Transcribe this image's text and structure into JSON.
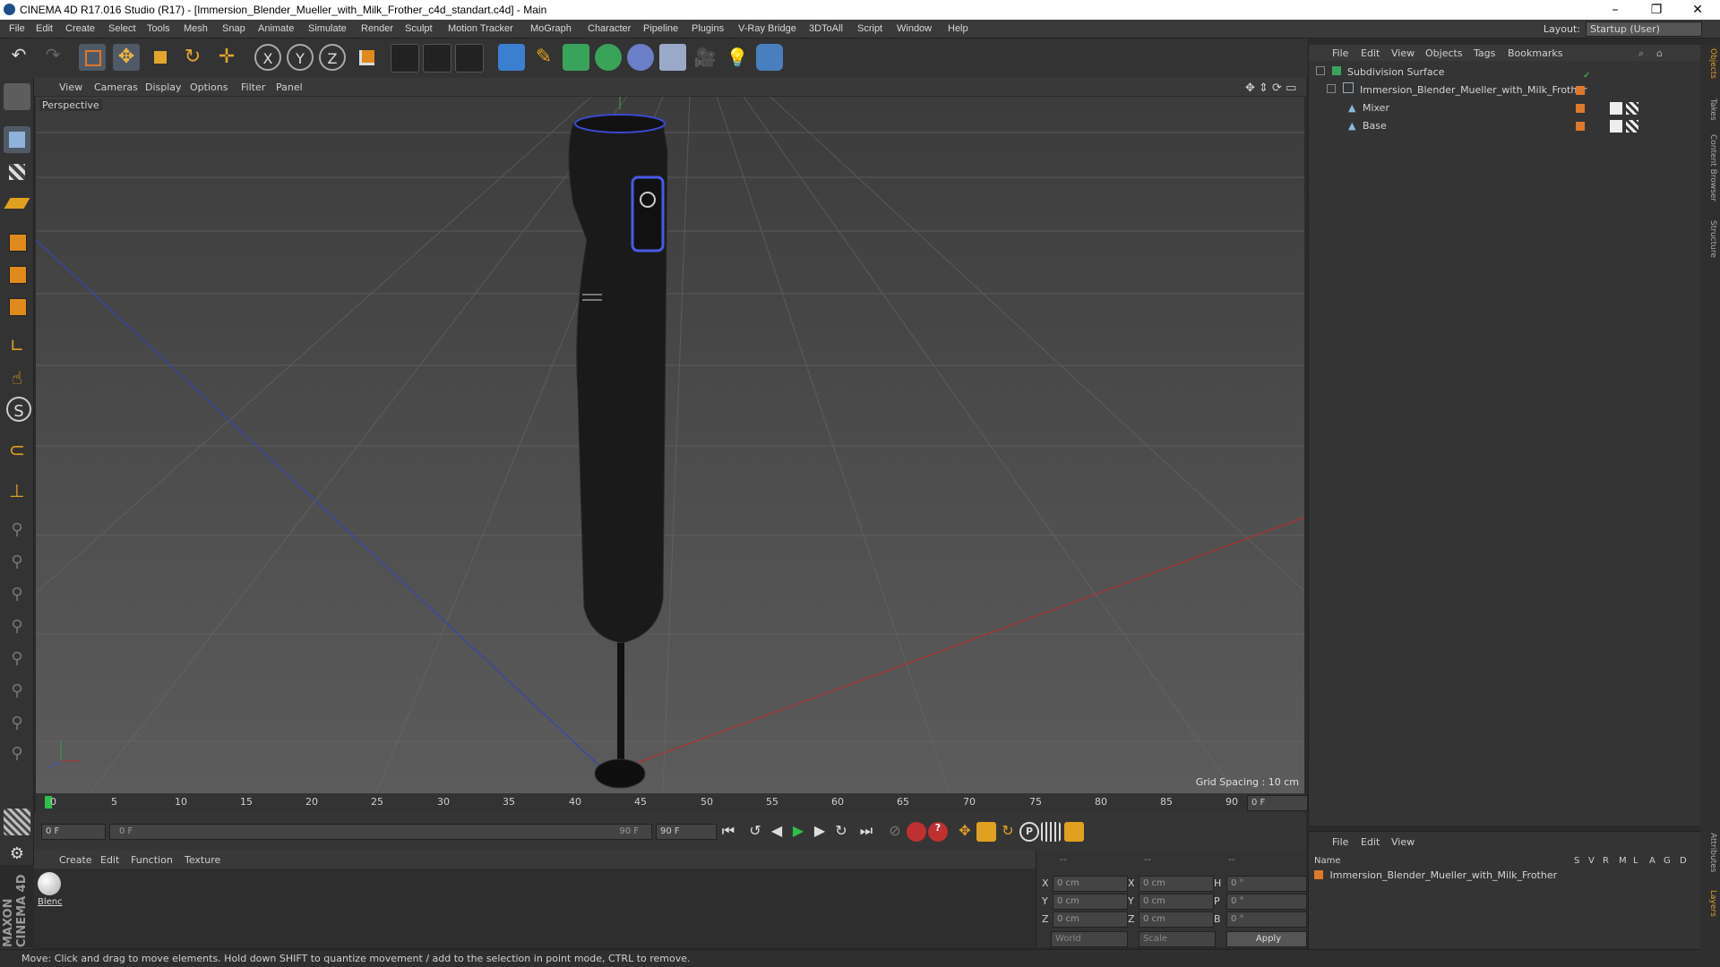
{
  "window": {
    "title": "CINEMA 4D R17.016 Studio (R17) - [Immersion_Blender_Mueller_with_Milk_Frother_c4d_standart.c4d] - Main",
    "minimize": "–",
    "maximize": "❐",
    "close": "✕"
  },
  "menubar": {
    "items": [
      "File",
      "Edit",
      "Create",
      "Select",
      "Tools",
      "Mesh",
      "Snap",
      "Animate",
      "Simulate",
      "Render",
      "Sculpt",
      "Motion Tracker",
      "MoGraph",
      "Character",
      "Pipeline",
      "Plugins",
      "V-Ray Bridge",
      "3DToAll",
      "Script",
      "Window",
      "Help"
    ],
    "layout_label": "Layout:",
    "layout_value": "Startup (User)"
  },
  "viewport": {
    "menu": [
      "View",
      "Cameras",
      "Display",
      "Options",
      "Filter",
      "Panel"
    ],
    "label": "Perspective",
    "grid_spacing": "Grid Spacing : 10 cm"
  },
  "timeline": {
    "ticks": [
      "0",
      "5",
      "10",
      "15",
      "20",
      "25",
      "30",
      "35",
      "40",
      "45",
      "50",
      "55",
      "60",
      "65",
      "70",
      "75",
      "80",
      "85",
      "90"
    ],
    "current_frame": "0 F",
    "start_field": "0 F",
    "range_start": "0 F",
    "range_end": "90 F",
    "end_field": "90 F"
  },
  "material_manager": {
    "menu": [
      "Create",
      "Edit",
      "Function",
      "Texture"
    ],
    "materials": [
      {
        "name": "Blenc"
      }
    ]
  },
  "coordinates": {
    "header_cols": [
      "--",
      "--",
      "--"
    ],
    "rows": [
      {
        "axis": "X",
        "pos": "0 cm",
        "size_axis": "X",
        "size": "0 cm",
        "rot_axis": "H",
        "rot": "0 °"
      },
      {
        "axis": "Y",
        "pos": "0 cm",
        "size_axis": "Y",
        "size": "0 cm",
        "rot_axis": "P",
        "rot": "0 °"
      },
      {
        "axis": "Z",
        "pos": "0 cm",
        "size_axis": "Z",
        "size": "0 cm",
        "rot_axis": "B",
        "rot": "0 °"
      }
    ],
    "mode": "World",
    "scale_mode": "Scale",
    "apply_label": "Apply"
  },
  "object_manager": {
    "menu": [
      "File",
      "Edit",
      "View",
      "Objects",
      "Tags",
      "Bookmarks"
    ],
    "objects": [
      {
        "name": "Subdivision Surface",
        "level": 0
      },
      {
        "name": "Immersion_Blender_Mueller_with_Milk_Frother",
        "level": 1
      },
      {
        "name": "Mixer",
        "level": 2
      },
      {
        "name": "Base",
        "level": 2
      }
    ]
  },
  "layer_manager": {
    "menu": [
      "File",
      "Edit",
      "View"
    ],
    "col_name": "Name",
    "cols": [
      "S",
      "V",
      "R",
      "M",
      "L",
      "A",
      "G",
      "D"
    ],
    "rows": [
      {
        "name": "Immersion_Blender_Mueller_with_Milk_Frother"
      }
    ]
  },
  "right_tabs": [
    "Objects",
    "Takes",
    "Content Browser",
    "Structure",
    "Attributes",
    "Layers"
  ],
  "brand": "MAXON CINEMA 4D",
  "status": "Move: Click and drag to move elements. Hold down SHIFT to quantize movement / add to the selection in point mode, CTRL to remove."
}
